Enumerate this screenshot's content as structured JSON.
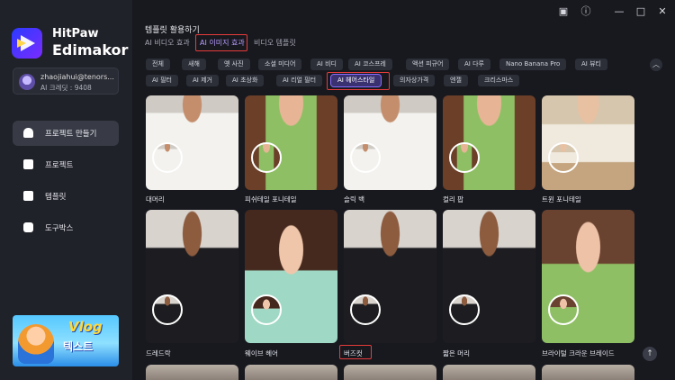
{
  "app": {
    "brand_line1": "HitPaw",
    "brand_line2": "Edimakor"
  },
  "user": {
    "email": "zhaojiahui@tenors...",
    "credits": "AI 크레딧 : 9408"
  },
  "sidebar": {
    "items": [
      {
        "label": "프로젝트 만들기",
        "icon": "home-icon",
        "active": true
      },
      {
        "label": "프로젝트",
        "icon": "folder-plus-icon",
        "active": false
      },
      {
        "label": "템플릿",
        "icon": "template-icon",
        "active": false
      },
      {
        "label": "도구박스",
        "icon": "toolbox-icon",
        "active": false
      }
    ]
  },
  "promo": {
    "title": "Vlog",
    "subtitle": "텍스트"
  },
  "window": {
    "feedback": "feedback-icon",
    "info": "info-icon",
    "minimize": "—",
    "maximize": "□",
    "close": "✕"
  },
  "section": {
    "title": "템플릿 활용하기"
  },
  "tabs": [
    {
      "label": "AI 비디오 효과",
      "active": false
    },
    {
      "label": "AI 이미지 효과",
      "active": true
    },
    {
      "label": "비디오 템플릿",
      "active": false
    }
  ],
  "chips_row1": [
    "전체",
    "새해",
    "옛 사진",
    "소셜 미디어",
    "AI 비디",
    "AI 코스프레",
    "액션 피규어",
    "AI 다루",
    "Nano Banana Pro",
    "AI 뷰티"
  ],
  "chips_row2": [
    "AI 필터",
    "AI 제거",
    "AI 초상화",
    "AI 리얼 필터",
    "AI 헤어스타일",
    "의자상가격",
    "엔젤",
    "크리스마스"
  ],
  "selected_chip": "AI 헤어스타일",
  "cards_row1": [
    "대머리",
    "피쉬테일 포니테일",
    "슬릭 백",
    "컬리 팝",
    "트윈 포니테일"
  ],
  "cards_row2": [
    "드레드락",
    "웨이브 헤어",
    "버즈컷",
    "짧은 머리",
    "브라이털 크라운 브레이드"
  ],
  "colors": {
    "accent": "#8a6cff",
    "highlight_border": "#e53b3b",
    "background": "#18191f"
  }
}
